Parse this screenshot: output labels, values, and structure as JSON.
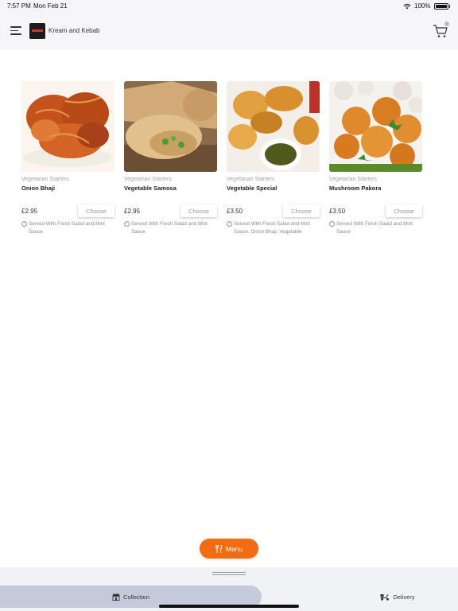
{
  "status_bar": {
    "time": "7:57 PM",
    "date": "Mon Feb 21",
    "battery": "100%"
  },
  "header": {
    "brand_name": "Kream and Kebab",
    "menu_icon": "hamburger-icon",
    "cart_icon": "cart-icon",
    "cart_badge": "0"
  },
  "items": [
    {
      "category": "Vegetarian Starters",
      "name": "Onion Bhaji",
      "price": "£2.95",
      "button": "Choose",
      "description": "Served With Fresh Salad and Mint Sauce"
    },
    {
      "category": "Vegetarian Starters",
      "name": "Vegetable Samosa",
      "price": "£2.95",
      "button": "Choose",
      "description": "Served With Fresh Salad and Mint Sauce"
    },
    {
      "category": "Vegetarian Starters",
      "name": "Vegetable Special",
      "price": "£3.50",
      "button": "Choose",
      "description": "Served With Fresh Salad and Mint Sauce. Onion Bhaji, Vegetable Samosa..."
    },
    {
      "category": "Vegetarian Starters",
      "name": "Mushroom Pakora",
      "price": "£3.50",
      "button": "Choose",
      "description": "Served With Fresh Salad and Mint Sauce"
    }
  ],
  "menu_button": {
    "label": "Menu",
    "icon": "fork-knife-icon"
  },
  "bottom_tabs": {
    "collection": {
      "label": "Collection",
      "icon": "shop-icon",
      "selected": true
    },
    "delivery": {
      "label": "Delivery",
      "icon": "scooter-icon",
      "selected": false
    }
  },
  "colors": {
    "accent": "#f26c12",
    "selected_tab": "#c4cad9",
    "panel": "#f1f2f6"
  }
}
